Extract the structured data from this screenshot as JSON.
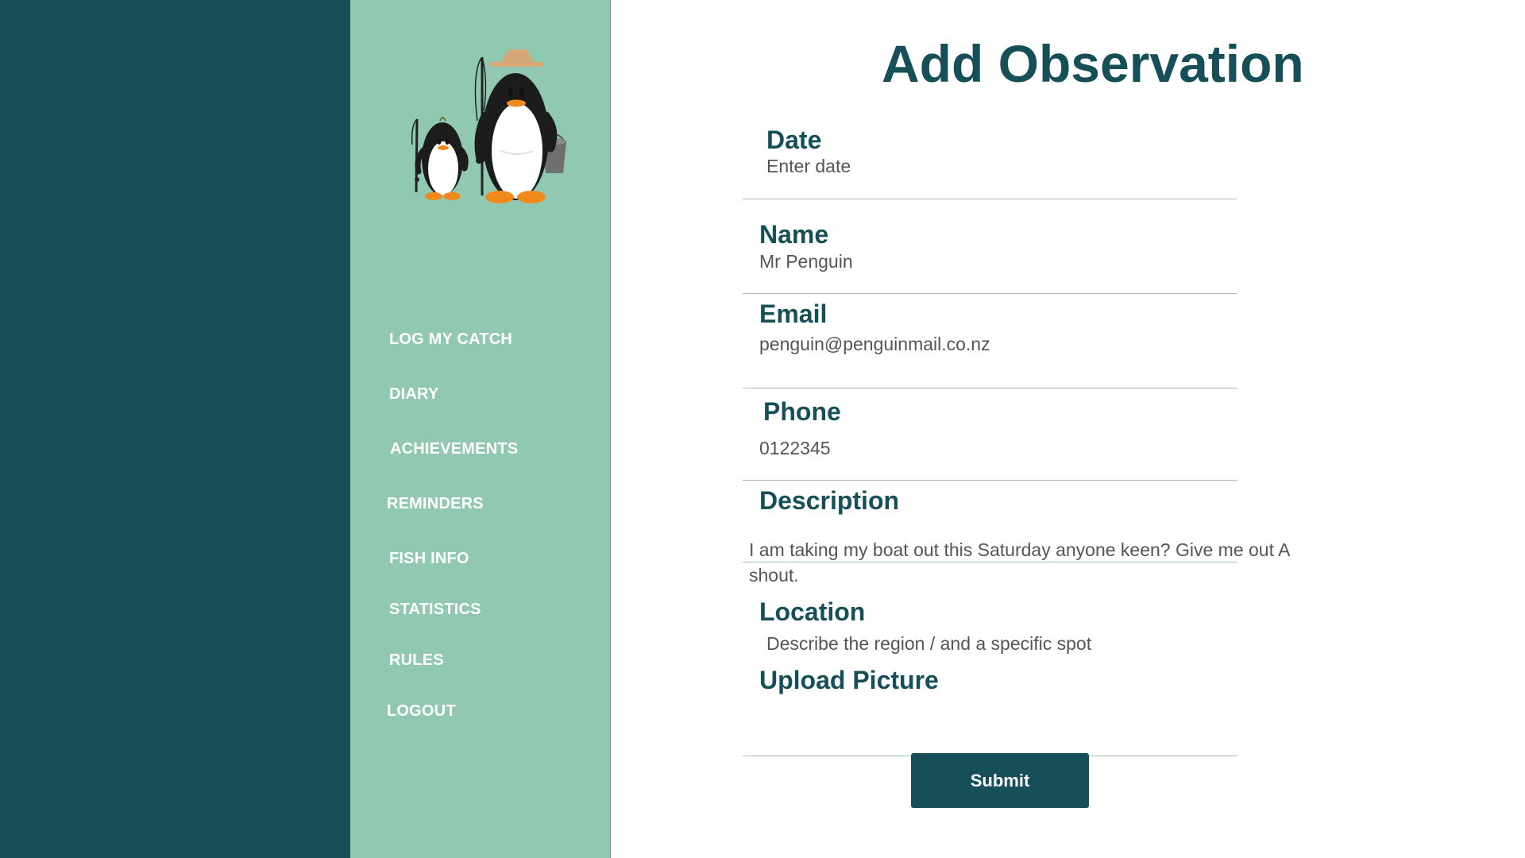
{
  "nav": {
    "items": [
      {
        "label": "LOG MY CATCH"
      },
      {
        "label": "DIARY"
      },
      {
        "label": "ACHIEVEMENTS"
      },
      {
        "label": "REMINDERS"
      },
      {
        "label": "FISH INFO"
      },
      {
        "label": "STATISTICS"
      },
      {
        "label": "RULES"
      },
      {
        "label": "LOGOUT"
      }
    ]
  },
  "form": {
    "title": "Add Observation",
    "date": {
      "label": "Date",
      "placeholder": "Enter date"
    },
    "name": {
      "label": "Name",
      "value": "Mr Penguin"
    },
    "email": {
      "label": "Email",
      "value": "penguin@penguinmail.co.nz"
    },
    "phone": {
      "label": "Phone",
      "value": "0122345"
    },
    "description": {
      "label": "Description",
      "value": "I am taking my boat out this Saturday anyone keen? Give me out A shout."
    },
    "location": {
      "label": "Location",
      "placeholder": "Describe the region / and a specific spot"
    },
    "upload": {
      "label": "Upload Picture"
    },
    "submit_label": "Submit"
  },
  "colors": {
    "dark_teal": "#164f58",
    "sidebar_green": "#90c8b1",
    "text_gray": "#555555",
    "divider": "#a7bcc0"
  },
  "icons": {
    "logo": "penguin-fishing-logo-icon"
  }
}
